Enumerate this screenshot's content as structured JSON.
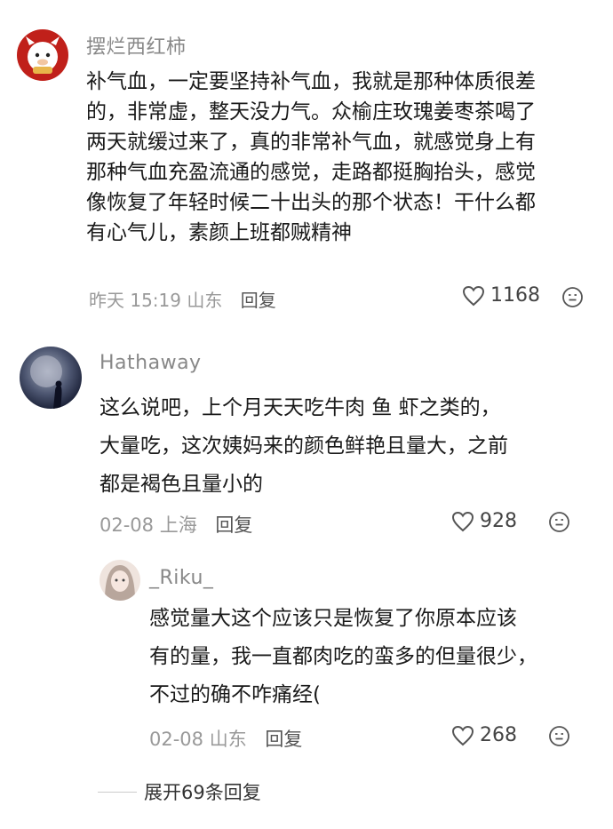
{
  "comments": [
    {
      "username": "摆烂西红柿",
      "lines": [
        "补气血，一定要坚持补气血，我就是那种体质很差",
        "的，非常虚，整天没力气。众榆庄玫瑰姜枣茶喝了",
        "两天就缓过来了，真的非常补气血，就感觉身上有",
        "那种气血充盈流通的感觉，走路都挺胸抬头，感觉",
        "像恢复了年轻时候二十出头的那个状态！干什么都",
        "有心气儿，素颜上班都贼精神"
      ],
      "time_location": "昨天 15:19 山东",
      "reply_label": "回复",
      "likes": "1168"
    },
    {
      "username": "Hathaway",
      "lines": [
        "这么说吧，上个月天天吃牛肉 鱼 虾之类的，",
        "大量吃，这次姨妈来的颜色鲜艳且量大，之前",
        "都是褐色且量小的"
      ],
      "time_location": "02-08 上海",
      "reply_label": "回复",
      "likes": "928"
    },
    {
      "username": "_Riku_",
      "lines": [
        "感觉量大这个应该只是恢复了你原本应该",
        "有的量，我一直都肉吃的蛮多的但量很少，",
        "不过的确不咋痛经("
      ],
      "time_location": "02-08 山东",
      "reply_label": "回复",
      "likes": "268"
    }
  ],
  "expand_label": "展开69条回复",
  "colors": {
    "avatar1_bg": "#c0201a",
    "text": "#1a1a1a",
    "meta": "#999999"
  }
}
